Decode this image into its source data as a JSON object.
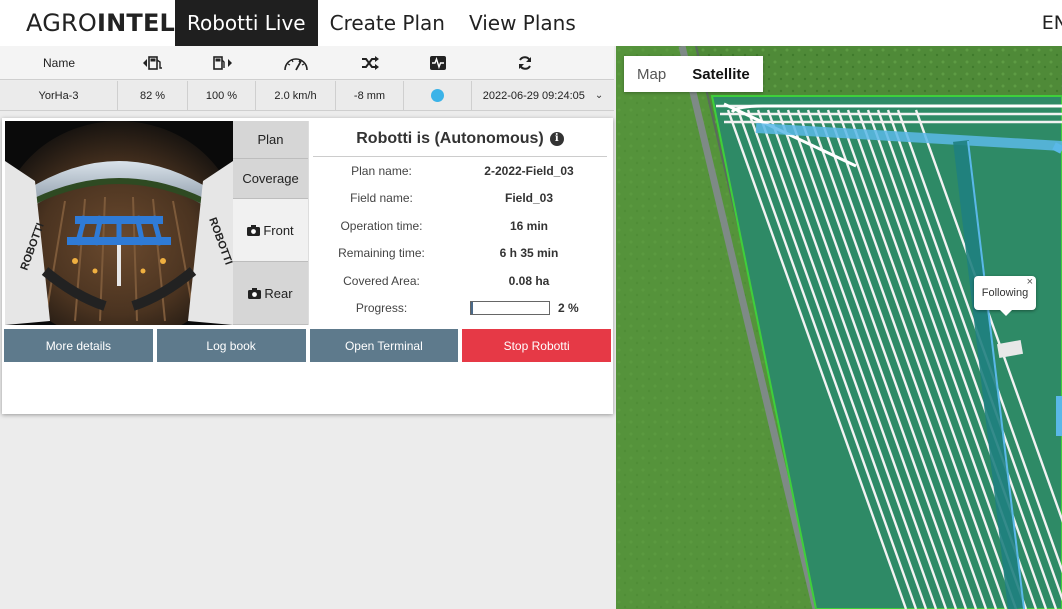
{
  "nav": {
    "brand_light": "AGRO",
    "brand_bold": "INTELLI",
    "tabs": [
      "Robotti Live",
      "Create Plan",
      "View Plans"
    ],
    "lang": "EN"
  },
  "status_header": {
    "name_label": "Name",
    "icons": [
      "fuel-left-icon",
      "fuel-right-icon",
      "speedometer-icon",
      "shuffle-icon",
      "pulse-icon",
      "refresh-icon"
    ]
  },
  "status_values": {
    "name": "YorHa-3",
    "fuel_left": "82 %",
    "fuel_right": "100 %",
    "speed": "2.0 km/h",
    "depth": "-8 mm",
    "status_color": "#3bb3e8",
    "timestamp": "2022-06-29 09:24:05"
  },
  "side_tabs": {
    "plan": "Plan",
    "coverage": "Coverage",
    "front": "Front",
    "rear": "Rear"
  },
  "info": {
    "title": "Robotti is (Autonomous)",
    "rows": [
      {
        "label": "Plan name:",
        "value": "2-2022-Field_03"
      },
      {
        "label": "Field name:",
        "value": "Field_03"
      },
      {
        "label": "Operation time:",
        "value": "16 min"
      },
      {
        "label": "Remaining time:",
        "value": "6 h 35 min"
      },
      {
        "label": "Covered Area:",
        "value": "0.08 ha"
      }
    ],
    "progress_label": "Progress:",
    "progress_value": 2,
    "progress_text": "2 %"
  },
  "buttons": {
    "details": "More details",
    "logbook": "Log book",
    "terminal": "Open Terminal",
    "stop": "Stop Robotti"
  },
  "map": {
    "toggle_map": "Map",
    "toggle_satellite": "Satellite",
    "active": "Satellite",
    "popup_text": "Following",
    "popup_close": "×"
  },
  "colors": {
    "stop_red": "#e63946",
    "button_slate": "#5e7a8c",
    "field_green": "#3fcf3a",
    "path_blue": "#5ab8e8"
  }
}
